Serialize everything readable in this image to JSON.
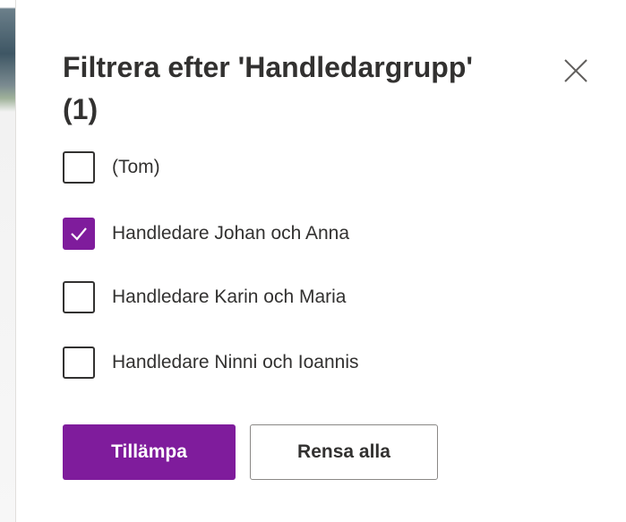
{
  "panel": {
    "title": "Filtrera efter 'Handledargrupp' (1)",
    "close_icon": "close-icon"
  },
  "options": [
    {
      "label": "(Tom)",
      "checked": false
    },
    {
      "label": "Handledare Johan och Anna",
      "checked": true
    },
    {
      "label": "Handledare Karin och Maria",
      "checked": false
    },
    {
      "label": "Handledare Ninni och Ioannis",
      "checked": false
    }
  ],
  "actions": {
    "apply_label": "Tillämpa",
    "clear_label": "Rensa alla"
  },
  "colors": {
    "accent": "#7f1c9c",
    "text": "#323130",
    "border": "#8a8886"
  }
}
